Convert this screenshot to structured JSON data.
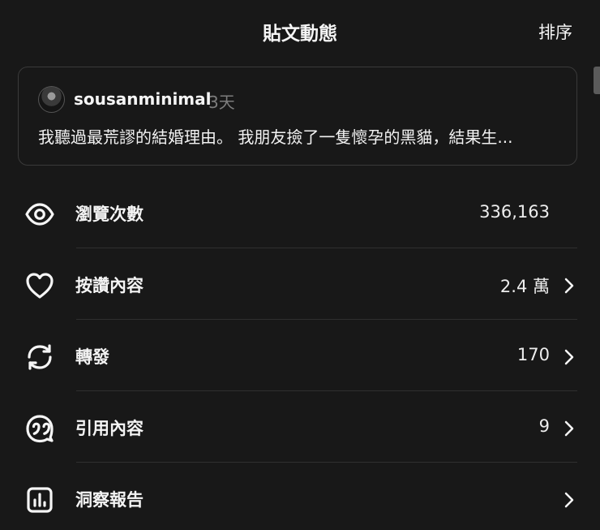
{
  "header": {
    "title": "貼文動態",
    "sort_label": "排序"
  },
  "post": {
    "username": "sousanminimal",
    "age": "3天",
    "snippet": "我聽過最荒謬的結婚理由。 我朋友撿了一隻懷孕的黑貓，結果生..."
  },
  "stats": [
    {
      "label": "瀏覽次數",
      "value": "336,163",
      "icon": "eye-icon"
    },
    {
      "label": "按讚內容",
      "value": "2.4 萬",
      "icon": "heart-icon"
    },
    {
      "label": "轉發",
      "value": "170",
      "icon": "repost-icon"
    },
    {
      "label": "引用內容",
      "value": "9",
      "icon": "quote-icon"
    },
    {
      "label": "洞察報告",
      "value": "",
      "icon": "insights-chart-icon"
    }
  ],
  "colors": {
    "background": "#181818",
    "text": "#f3f3f3",
    "muted": "#7d7d7d",
    "border": "#3a3a3a"
  }
}
